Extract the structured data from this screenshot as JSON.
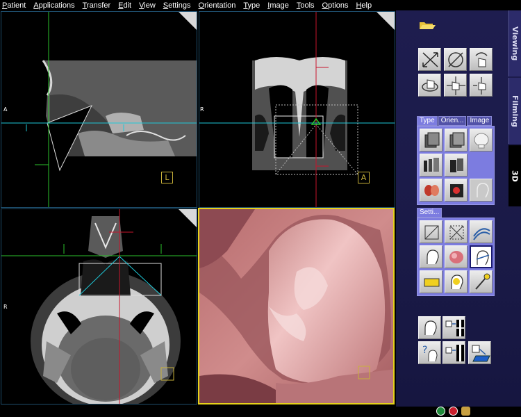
{
  "menu": [
    "Patient",
    "Applications",
    "Transfer",
    "Edit",
    "View",
    "Settings",
    "Orientation",
    "Type",
    "Image",
    "Tools",
    "Options",
    "Help"
  ],
  "viewports": {
    "sagittal": {
      "left_label": "A",
      "view_label": "L"
    },
    "coronal": {
      "left_label": "R",
      "view_label": "A"
    },
    "axial": {
      "left_label": "R"
    }
  },
  "side_tabs": [
    "Viewing",
    "Filming",
    "3D"
  ],
  "panel": {
    "type_tabs": [
      "Type",
      "Orien...",
      "Image"
    ],
    "settings_tab": "Setti..."
  },
  "icons": {
    "folder": "folder-open-icon",
    "status": [
      "green-circle-icon",
      "red-circle-icon",
      "figure-icon"
    ]
  },
  "colors": {
    "panel_bg": "#1e1d4f",
    "tab_active": "#7c7ce0",
    "view_3d_border": "#e6d21a",
    "crosshair_green": "#2cc22c",
    "crosshair_cyan": "#1ec8d8",
    "crosshair_red": "#c8142c",
    "rendering_pink": "#c97c7c"
  }
}
